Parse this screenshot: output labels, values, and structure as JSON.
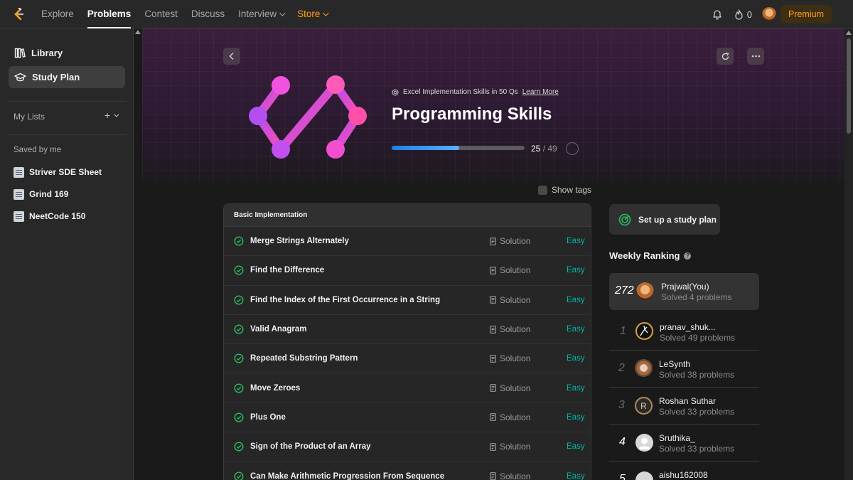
{
  "nav": {
    "links": [
      {
        "label": "Explore",
        "active": false
      },
      {
        "label": "Problems",
        "active": true
      },
      {
        "label": "Contest",
        "active": false
      },
      {
        "label": "Discuss",
        "active": false
      }
    ],
    "interview_label": "Interview",
    "store_label": "Store",
    "streak_count": "0",
    "premium_label": "Premium"
  },
  "sidebar": {
    "library_label": "Library",
    "study_plan_label": "Study Plan",
    "my_lists_label": "My Lists",
    "add_symbol": "+",
    "saved_label": "Saved by me",
    "saved_lists": [
      "Striver SDE Sheet",
      "Grind 169",
      "NeetCode 150"
    ]
  },
  "plan": {
    "badge_text": "Excel Implementation Skills in 50 Qs",
    "learn_more_label": "Learn More",
    "title": "Programming Skills",
    "progress_done": "25",
    "progress_total": "/ 49",
    "progress_fraction": 0.51,
    "show_tags_label": "Show tags"
  },
  "section": {
    "title": "Basic Implementation",
    "solution_label": "Solution",
    "problems": [
      {
        "title": "Merge Strings Alternately",
        "difficulty": "Easy"
      },
      {
        "title": "Find the Difference",
        "difficulty": "Easy"
      },
      {
        "title": "Find the Index of the First Occurrence in a String",
        "difficulty": "Easy"
      },
      {
        "title": "Valid Anagram",
        "difficulty": "Easy"
      },
      {
        "title": "Repeated Substring Pattern",
        "difficulty": "Easy"
      },
      {
        "title": "Move Zeroes",
        "difficulty": "Easy"
      },
      {
        "title": "Plus One",
        "difficulty": "Easy"
      },
      {
        "title": "Sign of the Product of an Array",
        "difficulty": "Easy"
      },
      {
        "title": "Can Make Arithmetic Progression From Sequence",
        "difficulty": "Easy"
      }
    ]
  },
  "right": {
    "setup_label": "Set up a study plan",
    "ranking_title": "Weekly Ranking",
    "rankings": [
      {
        "rank": "272",
        "name": "Prajwal(You)",
        "solved": "Solved 4 problems"
      },
      {
        "rank": "1",
        "name": "pranav_shuk...",
        "solved": "Solved 49 problems"
      },
      {
        "rank": "2",
        "name": "LeSynth",
        "solved": "Solved 38 problems"
      },
      {
        "rank": "3",
        "name": "Roshan Suthar",
        "solved": "Solved 33 problems"
      },
      {
        "rank": "4",
        "name": "Sruthika_",
        "solved": "Solved 33 problems"
      },
      {
        "rank": "5",
        "name": "aishu162008",
        "solved": ""
      }
    ],
    "avatar_letter": "R"
  },
  "colors": {
    "accent_orange": "#ffa116",
    "easy_green": "#00b8a3",
    "progress_blue": "#1e7fe6",
    "check_green": "#2cbb5d"
  },
  "icons": {
    "logo": "leetcode-logo-icon",
    "bell": "bell-icon",
    "streak": "fire-icon",
    "library": "library-books-icon",
    "study_plan": "graduation-cap-icon",
    "sheet": "sheet-icon",
    "check": "check-circle-icon",
    "solution": "document-icon",
    "target": "target-icon"
  }
}
